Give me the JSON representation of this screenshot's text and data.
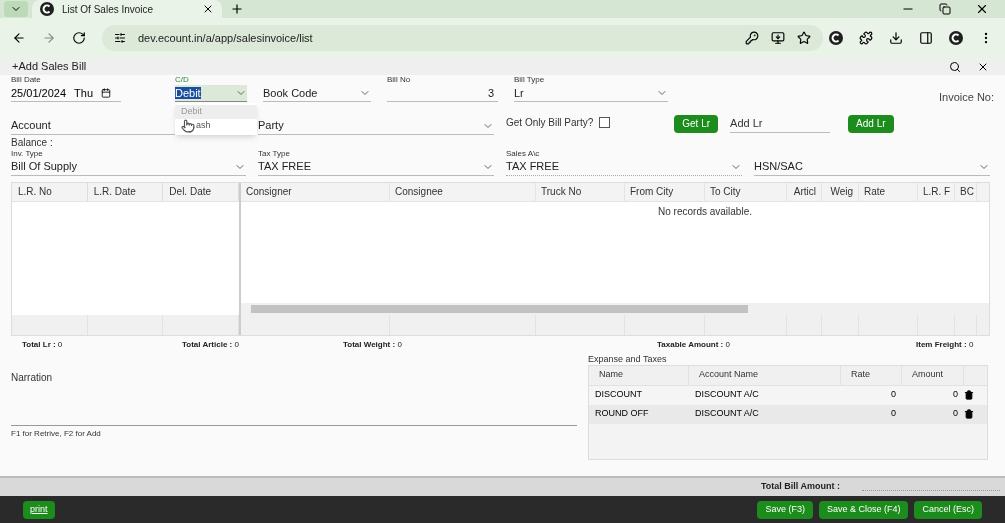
{
  "browser": {
    "tab_title": "List Of Sales Invoice",
    "url": "dev.ecount.in/a/app/salesinvoice/list"
  },
  "form": {
    "title": "+Add Sales Bill",
    "bill_date": {
      "label": "Bill Date",
      "value": "25/01/2024",
      "day": "Thu"
    },
    "cd": {
      "label": "C/D",
      "value": "Debit",
      "options": [
        {
          "label": "Debit",
          "selected": true
        },
        {
          "label": "ash",
          "selected": false
        }
      ]
    },
    "book_code": {
      "placeholder": "Book Code"
    },
    "bill_no": {
      "label": "Bill No",
      "value": "3"
    },
    "bill_type": {
      "label": "Bill Type",
      "value": "Lr"
    },
    "invoice_no": "Invoice No:",
    "account": {
      "placeholder": "Account"
    },
    "party": {
      "placeholder": "Party"
    },
    "get_only_bill_party": {
      "label": "Get Only Bill Party?",
      "checked": false
    },
    "get_lr_button": "Get Lr",
    "add_lr": {
      "placeholder": "Add Lr"
    },
    "add_lr_button": "Add Lr",
    "balance": "Balance :",
    "inv_type": {
      "label": "Inv. Type",
      "value": "Bill Of Supply"
    },
    "tax_type": {
      "label": "Tax Type",
      "value": "TAX FREE"
    },
    "sales_ac": {
      "label": "Sales A\\c",
      "value": "TAX FREE"
    },
    "hsn": {
      "placeholder": "HSN/SAC"
    }
  },
  "grid": {
    "frozen_columns": [
      "L.R. No",
      "L.R. Date",
      "Del. Date"
    ],
    "columns": [
      "Consigner",
      "Consignee",
      "Truck No",
      "From City",
      "To City",
      "Articl",
      "Weig",
      "Rate",
      "L.R. F",
      "BC"
    ],
    "empty_message": "No records available."
  },
  "totals": [
    {
      "label": "Total Lr :",
      "value": "0"
    },
    {
      "label": "Total Article :",
      "value": "0"
    },
    {
      "label": "Total Weight :",
      "value": "0"
    },
    {
      "label": "Taxable Amount :",
      "value": "0"
    },
    {
      "label": "Item Freight :",
      "value": "0"
    }
  ],
  "narration": {
    "label": "Narration",
    "hint": "F1 for Retrive, F2 for Add"
  },
  "expenses": {
    "title": "Expanse and Taxes",
    "columns": [
      "Name",
      "Account Name",
      "Rate",
      "Amount"
    ],
    "rows": [
      {
        "name": "DISCOUNT",
        "account": "DISCOUNT A/C",
        "rate": "0",
        "amount": "0"
      },
      {
        "name": "ROUND OFF",
        "account": "DISCOUNT A/C",
        "rate": "0",
        "amount": "0"
      }
    ]
  },
  "total_bill": {
    "label": "Total Bill Amount :"
  },
  "footer": {
    "print_button": "print",
    "actions": [
      "Save (F3)",
      "Save & Close (F4)",
      "Cancel (Esc)"
    ]
  }
}
